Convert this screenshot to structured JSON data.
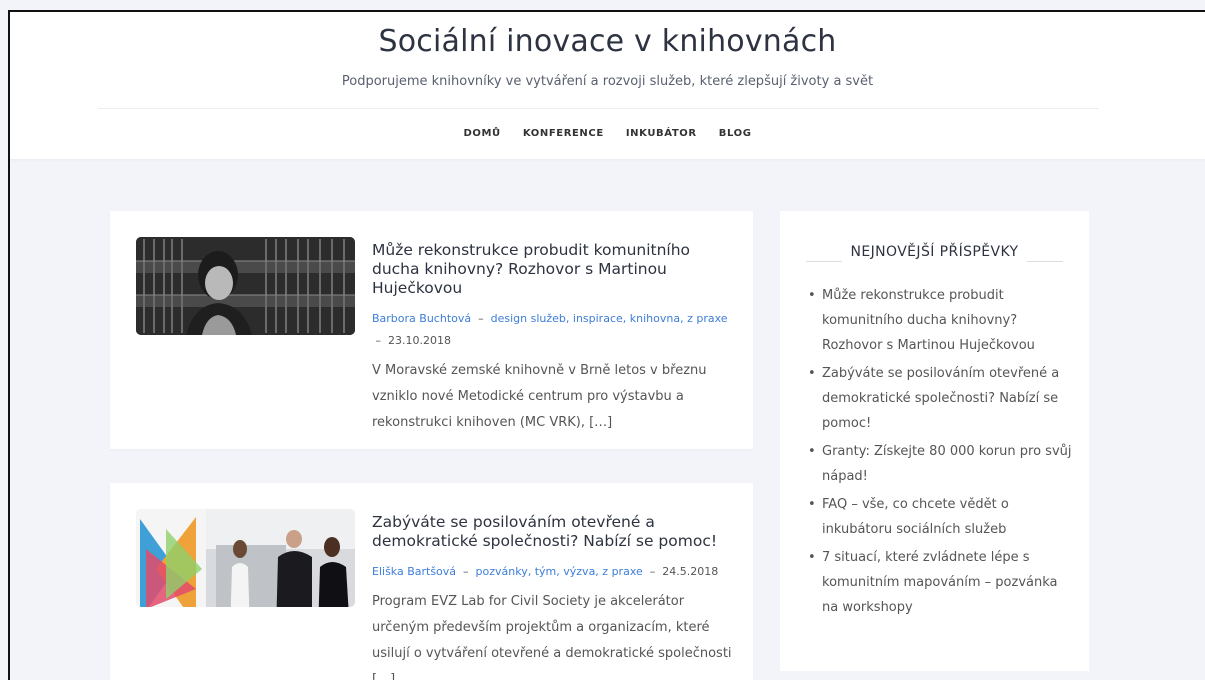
{
  "site": {
    "title": "Sociální inovace v knihovnách",
    "description": "Podporujeme knihovníky ve vytváření a rozvoji služeb, které zlepšují životy a svět"
  },
  "nav": [
    "DOMŮ",
    "KONFERENCE",
    "INKUBÁTOR",
    "BLOG"
  ],
  "posts": [
    {
      "title": "Může rekonstrukce probudit komunitního ducha knihovny? Rozhovor s Martinou Huječkovou",
      "author": "Barbora Buchtová",
      "categories": "design služeb, inspirace, knihovna, z praxe",
      "date": "23.10.2018",
      "excerpt": "V Moravské zemské knihovně v Brně letos v březnu vzniklo nové Metodické centrum pro výstavbu a rekonstrukci knihoven (MC VRK), […]"
    },
    {
      "title": "Zabýváte se posilováním otevřené a demokratické společnosti? Nabízí se pomoc!",
      "author": "Eliška Bartšová",
      "categories": "pozvánky, tým, výzva, z praxe",
      "date": "24.5.2018",
      "excerpt": "Program EVZ Lab for Civil Society je akcelerátor určeným především projektům a organizacím, které usilují o vytváření otevřené a demokratické společnosti […]"
    }
  ],
  "sidebar": {
    "title": "NEJNOVĚJŠÍ PŘÍSPĚVKY",
    "items": [
      "Může rekonstrukce probudit komunitního ducha knihovny? Rozhovor s Martinou Huječkovou",
      "Zabýváte se posilováním otevřené a demokratické společnosti? Nabízí se pomoc!",
      "Granty: Získejte 80 000 korun pro svůj nápad!",
      "FAQ – vše, co chcete vědět o inkubátoru sociálních služeb",
      "7 situací, které zvládnete lépe s komunitním mapováním – pozvánka na workshopy"
    ]
  },
  "thumbnail_logo": "evz",
  "colors": {
    "link": "#3d7dd8",
    "background": "#f2f4f9",
    "card": "#ffffff"
  }
}
